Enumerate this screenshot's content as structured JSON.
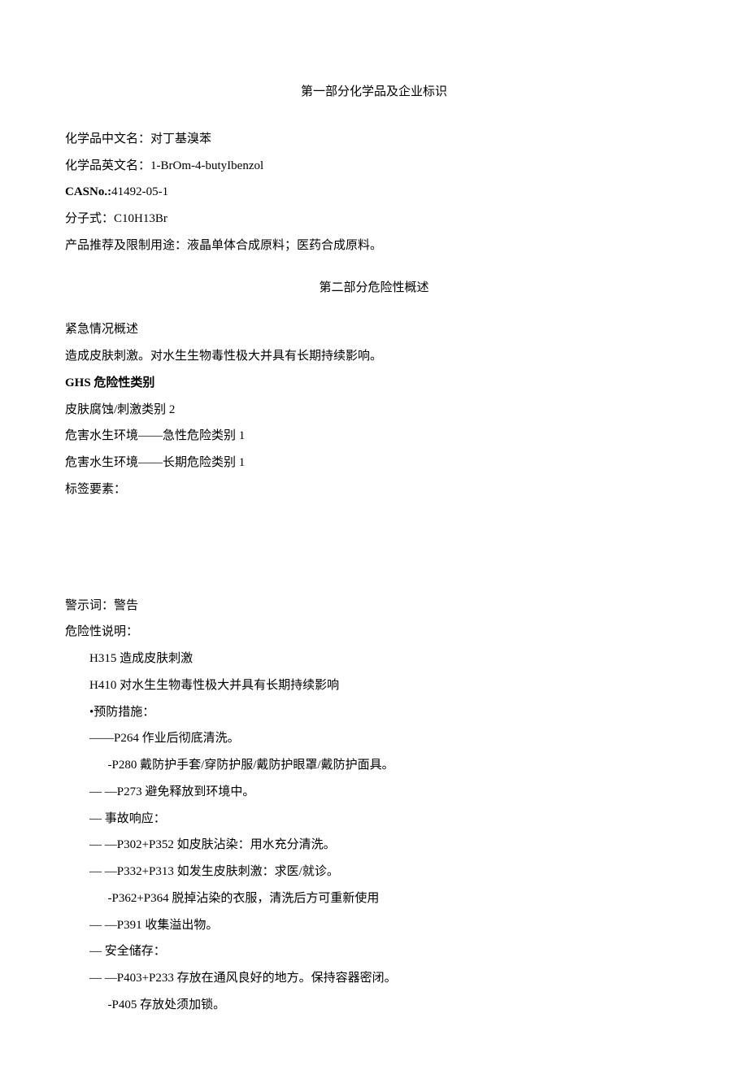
{
  "section1": {
    "title": "第一部分化学品及企业标识",
    "name_cn_label": "化学品中文名：",
    "name_cn": "对丁基溴苯",
    "name_en_label": "化学品英文名：",
    "name_en": "1-BrOm-4-butyIbenzol",
    "cas_label": "CASNo.:",
    "cas": "41492-05-1",
    "formula_label": "分子式：",
    "formula": "C10H13Br",
    "usage_label": "产品推荐及限制用途：",
    "usage": "液晶单体合成原料；医药合成原料。"
  },
  "section2": {
    "title": "第二部分危险性概述",
    "emergency_label": "紧急情况概述",
    "emergency_text": "造成皮肤刺激。对水生生物毒性极大并具有长期持续影响。",
    "ghs_label": "GHS 危险性类别",
    "ghs1": "皮肤腐蚀/刺激类别 2",
    "ghs2": "危害水生环境——急性危险类别 1",
    "ghs3": "危害水生环境——长期危险类别 1",
    "label_elements": "标签要素：",
    "signal_word_label": "警示词：",
    "signal_word": "警告",
    "hazard_label": "危险性说明：",
    "h315": "H315 造成皮肤刺激",
    "h410": "H410 对水生生物毒性极大并具有长期持续影响",
    "prevention_label": "•预防措施：",
    "p264": "——P264 作业后彻底清洗。",
    "p280": "-P280 戴防护手套/穿防护服/戴防护眼罩/戴防护面具。",
    "p273": "—   —P273 避免释放到环境中。",
    "response_label": "—  事故响应：",
    "p302": "— —P302+P352 如皮肤沾染：用水充分清洗。",
    "p332": "—   —P332+P313 如发生皮肤刺激：求医/就诊。",
    "p362": "-P362+P364 脱掉沾染的衣服，清洗后方可重新使用",
    "p391": "— —P391 收集溢出物。",
    "storage_label": "—  安全储存：",
    "p403": "—    —P403+P233 存放在通风良好的地方。保持容器密闭。",
    "p405": "-P405 存放处须加锁。"
  }
}
